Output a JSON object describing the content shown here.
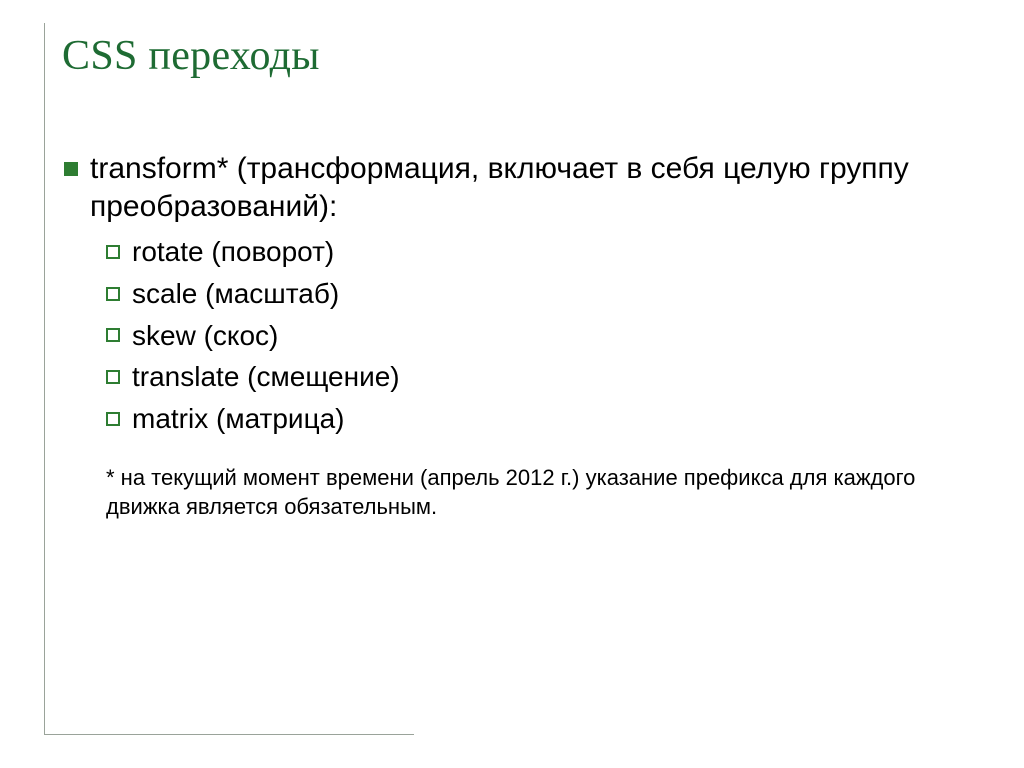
{
  "title": "CSS переходы",
  "main": {
    "heading": "transform* (трансформация, включает в себя целую группу преобразований):",
    "sub_items": [
      "rotate (поворот)",
      "scale (масштаб)",
      "skew (скос)",
      "translate (смещение)",
      "matrix (матрица)"
    ]
  },
  "footnote": "* на текущий момент времени (апрель 2012 г.) указание префикса для каждого движка является обязательным."
}
